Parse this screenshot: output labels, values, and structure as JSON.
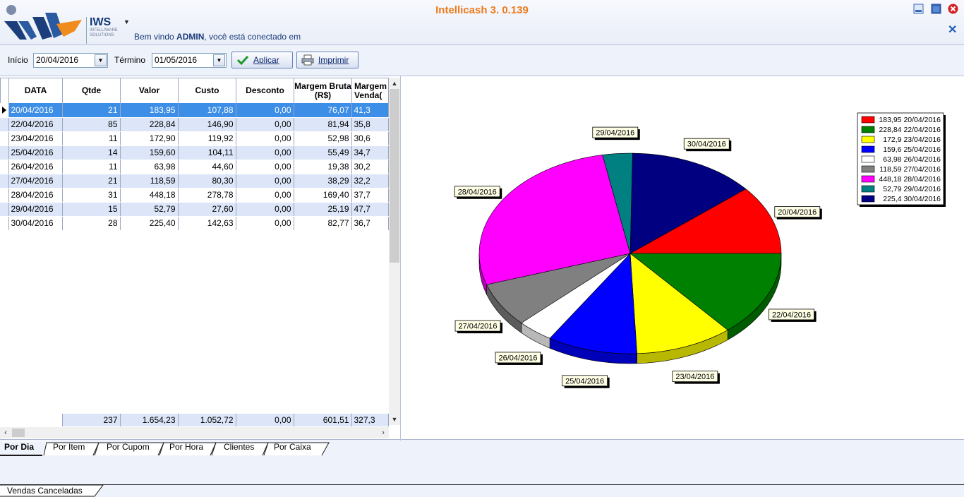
{
  "app": {
    "title": "Intellicash 3. 0.139",
    "logo_name": "IWS",
    "logo_subtitle": "INTELLIWARE SOLUTIONS",
    "welcome_prefix": "Bem vindo ",
    "welcome_user": "ADMIN",
    "welcome_suffix": ", você está conectado em"
  },
  "toolbar": {
    "start_label": "Início",
    "start_value": "20/04/2016",
    "end_label": "Término",
    "end_value": "01/05/2016",
    "apply_label": "Aplicar",
    "print_label": "Imprimir"
  },
  "grid": {
    "columns": [
      {
        "label": "DATA"
      },
      {
        "label": "Qtde"
      },
      {
        "label": "Valor"
      },
      {
        "label": "Custo"
      },
      {
        "label": "Desconto"
      },
      {
        "label": "Margem Bruta (R$)"
      },
      {
        "label": "Margem Venda("
      }
    ],
    "rows": [
      [
        "20/04/2016",
        "21",
        "183,95",
        "107,88",
        "0,00",
        "76,07",
        "41,3"
      ],
      [
        "22/04/2016",
        "85",
        "228,84",
        "146,90",
        "0,00",
        "81,94",
        "35,8"
      ],
      [
        "23/04/2016",
        "11",
        "172,90",
        "119,92",
        "0,00",
        "52,98",
        "30,6"
      ],
      [
        "25/04/2016",
        "14",
        "159,60",
        "104,11",
        "0,00",
        "55,49",
        "34,7"
      ],
      [
        "26/04/2016",
        "11",
        "63,98",
        "44,60",
        "0,00",
        "19,38",
        "30,2"
      ],
      [
        "27/04/2016",
        "21",
        "118,59",
        "80,30",
        "0,00",
        "38,29",
        "32,2"
      ],
      [
        "28/04/2016",
        "31",
        "448,18",
        "278,78",
        "0,00",
        "169,40",
        "37,7"
      ],
      [
        "29/04/2016",
        "15",
        "52,79",
        "27,60",
        "0,00",
        "25,19",
        "47,7"
      ],
      [
        "30/04/2016",
        "28",
        "225,40",
        "142,63",
        "0,00",
        "82,77",
        "36,7"
      ]
    ],
    "selected_row": 0,
    "totals": [
      "237",
      "1.654,23",
      "1.052,72",
      "0,00",
      "601,51",
      "327,3"
    ]
  },
  "chart_data": {
    "type": "pie",
    "slices": [
      {
        "label": "20/04/2016",
        "value": 183.95,
        "legend": "183,95 20/04/2016",
        "color": "#ff0000"
      },
      {
        "label": "22/04/2016",
        "value": 228.84,
        "legend": "228,84 22/04/2016",
        "color": "#008000"
      },
      {
        "label": "23/04/2016",
        "value": 172.9,
        "legend": "172,9 23/04/2016",
        "color": "#ffff00"
      },
      {
        "label": "25/04/2016",
        "value": 159.6,
        "legend": "159,6 25/04/2016",
        "color": "#0000ff"
      },
      {
        "label": "26/04/2016",
        "value": 63.98,
        "legend": "63,98 26/04/2016",
        "color": "#ffffff"
      },
      {
        "label": "27/04/2016",
        "value": 118.59,
        "legend": "118,59 27/04/2016",
        "color": "#808080"
      },
      {
        "label": "28/04/2016",
        "value": 448.18,
        "legend": "448,18 28/04/2016",
        "color": "#ff00ff"
      },
      {
        "label": "29/04/2016",
        "value": 52.79,
        "legend": "52,79 29/04/2016",
        "color": "#008080"
      },
      {
        "label": "30/04/2016",
        "value": 225.4,
        "legend": "225,4 30/04/2016",
        "color": "#000080"
      }
    ],
    "legend_position": "top-right"
  },
  "tabs": {
    "items": [
      {
        "label": "Por Dia",
        "active": true
      },
      {
        "label": "Por Item",
        "active": false
      },
      {
        "label": "Por Cupom",
        "active": false
      },
      {
        "label": "Por Hora",
        "active": false
      },
      {
        "label": "Clientes",
        "active": false
      },
      {
        "label": "Por Caixa",
        "active": false
      }
    ],
    "bottom_tab_label": "Vendas Canceladas"
  }
}
